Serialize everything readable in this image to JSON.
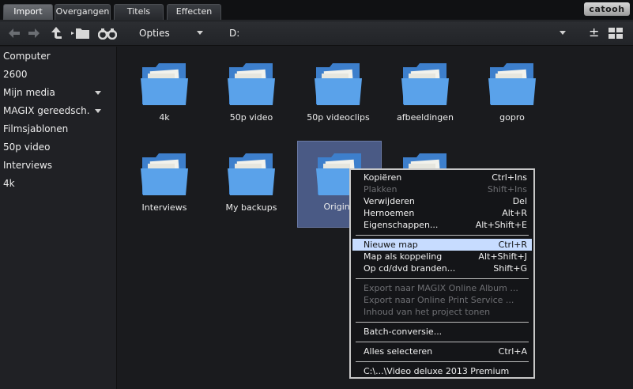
{
  "tabs": [
    {
      "label": "Import",
      "active": true
    },
    {
      "label": "Overgangen",
      "active": false
    },
    {
      "label": "Titels",
      "active": false
    },
    {
      "label": "Effecten",
      "active": false
    }
  ],
  "brand": "catooh",
  "toolbar": {
    "options_label": "Opties",
    "path_label": "D:",
    "icons": [
      "back-arrow-icon",
      "forward-arrow-icon",
      "up-folder-icon",
      "folder-browse-icon",
      "binoculars-icon",
      "plus-minus-icon",
      "grid-view-icon"
    ],
    "plus_minus": "±"
  },
  "sidebar": {
    "items": [
      {
        "label": "Computer",
        "has_caret": false
      },
      {
        "label": "2600",
        "has_caret": false
      },
      {
        "label": "Mijn media",
        "has_caret": true
      },
      {
        "label": "MAGIX gereedsch.",
        "has_caret": true
      },
      {
        "label": "Filmsjablonen",
        "has_caret": false
      },
      {
        "label": "50p video",
        "has_caret": false
      },
      {
        "label": "Interviews",
        "has_caret": false
      },
      {
        "label": "4k",
        "has_caret": false
      }
    ]
  },
  "folders": [
    {
      "label": "4k"
    },
    {
      "label": "50p video"
    },
    {
      "label": "50p videoclips"
    },
    {
      "label": "afbeeldingen"
    },
    {
      "label": "gopro"
    },
    {
      "label": "Interviews"
    },
    {
      "label": "My backups"
    },
    {
      "label": "Origine",
      "selected": true
    },
    {
      "label": ""
    }
  ],
  "context_menu": {
    "items": [
      {
        "label": "Kopiëren",
        "shortcut": "Ctrl+Ins",
        "disabled": false
      },
      {
        "label": "Plakken",
        "shortcut": "Shift+Ins",
        "disabled": true
      },
      {
        "label": "Verwijderen",
        "shortcut": "Del",
        "disabled": false
      },
      {
        "label": "Hernoemen",
        "shortcut": "Alt+R",
        "disabled": false
      },
      {
        "label": "Eigenschappen...",
        "shortcut": "Alt+Shift+E",
        "disabled": false
      },
      {
        "label": "Nieuwe map",
        "shortcut": "Ctrl+R",
        "disabled": false,
        "highlighted": true
      },
      {
        "label": "Map als koppeling",
        "shortcut": "Alt+Shift+J",
        "disabled": false
      },
      {
        "label": "Op cd/dvd branden...",
        "shortcut": "Shift+G",
        "disabled": false
      },
      {
        "label": "Export naar MAGIX Online Album ...",
        "shortcut": "",
        "disabled": true
      },
      {
        "label": "Export naar Online Print Service ...",
        "shortcut": "",
        "disabled": true
      },
      {
        "label": "Inhoud van het project tonen",
        "shortcut": "",
        "disabled": true
      },
      {
        "label": "Batch-conversie...",
        "shortcut": "",
        "disabled": false
      },
      {
        "label": "Alles selecteren",
        "shortcut": "Ctrl+A",
        "disabled": false
      },
      {
        "label": "C:\\...\\Video deluxe 2013 Premium",
        "shortcut": "",
        "disabled": false
      }
    ]
  },
  "colors": {
    "folder_blue": "#5a9ee6",
    "selection": "#4a5a85",
    "menu_highlight": "#c7dcff"
  }
}
